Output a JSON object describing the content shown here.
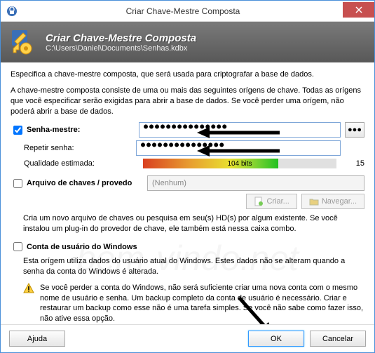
{
  "window": {
    "title": "Criar Chave-Mestre Composta"
  },
  "banner": {
    "title": "Criar Chave-Mestre Composta",
    "path": "C:\\Users\\Daniel\\Documents\\Senhas.kdbx"
  },
  "intro1": "Especifica a chave-mestre composta, que será usada para criptografar a base de dados.",
  "intro2": "A chave-mestre composta consiste de uma ou mais das seguintes orígens de chave. Todas as orígens que você especificar serão exigidas para abrir a base de dados. Se você perder uma orígem, não poderá abrir a base de dados.",
  "master": {
    "checked": true,
    "label": "Senha-mestre:",
    "value": "●●●●●●●●●●●●●●●",
    "dots_btn": "●●●"
  },
  "repeat": {
    "label": "Repetir senha:",
    "value": "●●●●●●●●●●●●●●●"
  },
  "quality": {
    "label": "Qualidade estimada:",
    "bits": "104 bits",
    "length": "15"
  },
  "keyfile": {
    "checked": false,
    "label": "Arquivo de chaves / provedo",
    "combo": "(Nenhum)",
    "create": "Criar...",
    "browse": "Navegar...",
    "desc": "Cria um novo arquivo de chaves ou pesquisa em seu(s) HD(s) por algum existente. Se você instalou um plug-in do provedor de chave, ele também está nessa caixa combo."
  },
  "winacct": {
    "checked": false,
    "label": "Conta de usuário do Windows",
    "desc": "Esta orígem utiliza dados do usuário atual do Windows. Estes dados não se alteram quando a senha da conta do Windows é alterada.",
    "warn": "Se você perder a conta do Windows, não será suficiente criar uma nova conta com o mesmo nome de usuário e senha. Um backup completo da conta de usuário é necessário. Criar e restaurar um backup como esse não é uma tarefa simples. Se você não sabe como fazer isso, não ative essa opção."
  },
  "buttons": {
    "help": "Ajuda",
    "ok": "OK",
    "cancel": "Cancelar"
  },
  "watermark": "bem-vindo.net"
}
